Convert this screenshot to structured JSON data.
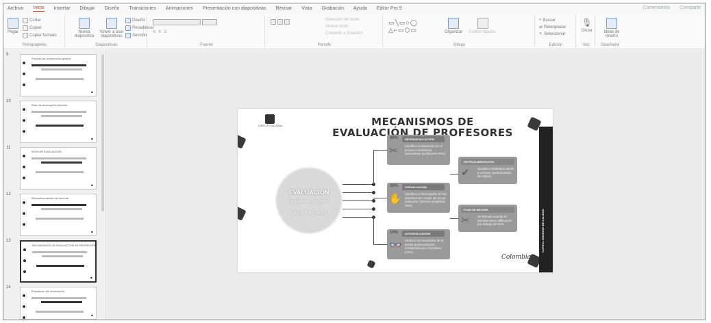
{
  "tabs": [
    "Archivo",
    "Inicio",
    "Insertar",
    "Dibujar",
    "Diseño",
    "Transiciones",
    "Animaciones",
    "Presentación con diapositivas",
    "Revisar",
    "Vista",
    "Grabación",
    "Ayuda",
    "Editor Pro 9"
  ],
  "active_tab": "Inicio",
  "share": {
    "comments": "Comentarios",
    "share": "Compartir"
  },
  "ribbon": {
    "clipboard": {
      "paste": "Pegar",
      "cut": "Cortar",
      "copy": "Copiar",
      "format_painter": "Copiar formato",
      "label": "Portapapeles"
    },
    "slides": {
      "new_slide": "Nueva diapositiva",
      "reuse": "Volver a usar diapositivas",
      "layout": "Diseño",
      "reset": "Restablecer",
      "section": "Sección",
      "label": "Diapositivas"
    },
    "font": {
      "label": "Fuente"
    },
    "paragraph": {
      "label": "Párrafo",
      "text_direction": "Dirección del texto",
      "align_text": "Alinear texto",
      "smartart": "Convertir a SmartArt"
    },
    "drawing": {
      "arrange": "Organizar",
      "quick_styles": "Estilos rápidos",
      "label": "Dibujo"
    },
    "editing": {
      "find": "Buscar",
      "replace": "Reemplazar",
      "select": "Seleccionar",
      "label": "Edición"
    },
    "voice": {
      "dictate": "Dictar",
      "label": "Voz"
    },
    "designer": {
      "ideas": "Ideas de diseño",
      "label": "Diseñador"
    }
  },
  "thumbnails": [
    {
      "num": "9",
      "title": "Proceso de construcción gestión"
    },
    {
      "num": "10",
      "title": "Ruta del desempeño docente"
    },
    {
      "num": "11",
      "title": "RUTA DE EVALUACIÓN"
    },
    {
      "num": "12",
      "title": "Retroalimentación del docente"
    },
    {
      "num": "13",
      "title": "MECANISMOS DE EVALUACIÓN DE PROFESORES"
    },
    {
      "num": "14",
      "title": "Evaluación del desempeño"
    }
  ],
  "slide": {
    "title_line1": "MECANISMOS DE",
    "title_line2": "EVALUACIÓN DE PROFESORES",
    "emblem_label": "EJÉRCITO NACIONAL",
    "center": {
      "title": "EVALUACIÓN",
      "sub1": "DESEMPEÑO DOCENTE",
      "sub2": "SACEF - CAPÍTULO 8"
    },
    "cards": [
      {
        "pct": "60%",
        "header": "HETEROEVALUACIÓN",
        "body": "Identifica el desarrollo en el proceso enseñanza aprendizaje (profesores 60%)",
        "icon": "✂"
      },
      {
        "pct": "30%",
        "header": "COEVALUACIÓN",
        "body": "Identifica el desempeño de los docentes por medio de un par evaluador (Director programa 30%)",
        "icon": "✋"
      },
      {
        "pct": "10%",
        "header": "AUTOEVALUACIÓN",
        "body": "Verificar los resultados de la propia autoevaluación completado por el profesor (10%)",
        "icon": "👓"
      }
    ],
    "right_cards": [
      {
        "header": "RETROALIMENTACIÓN",
        "body": "Socializa resultados dando a conocer oportunidades de mejora",
        "icon": "✔"
      },
      {
        "header": "PLAN DE MEJORA",
        "body": "Se formula cuando el docente tiene calificación por debajo del 80%",
        "icon": "✂"
      }
    ],
    "sidebar_text": "CAPITAL DOCENTE DE CALIDAD",
    "brand": "Colombia"
  }
}
